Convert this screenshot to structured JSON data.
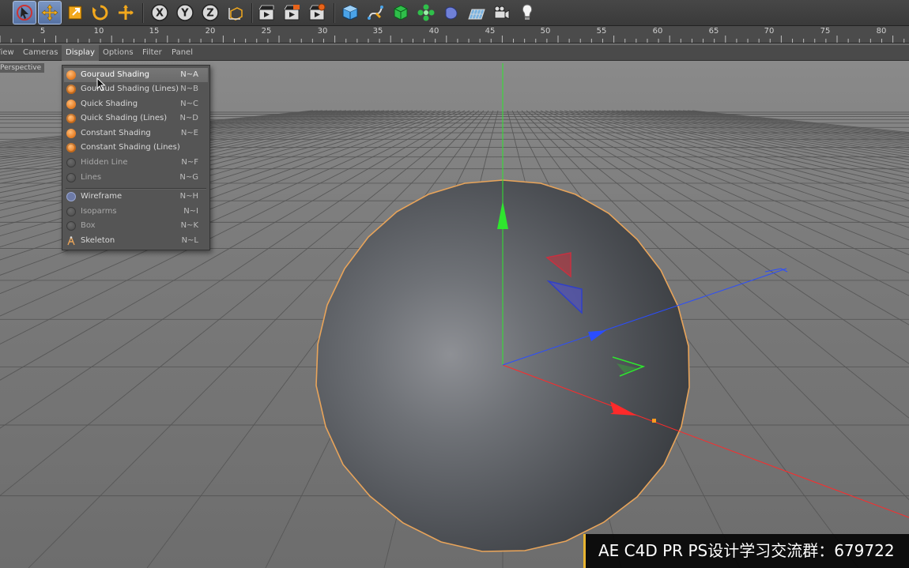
{
  "toolbar": {
    "tools": [
      {
        "name": "live-selection-icon",
        "active": true
      },
      {
        "name": "move-icon",
        "active": true
      },
      {
        "name": "scale-icon",
        "active": false
      },
      {
        "name": "rotate-icon",
        "active": false
      },
      {
        "name": "last-tool-icon",
        "active": false
      },
      {
        "name": "x-axis-lock-icon",
        "active": false
      },
      {
        "name": "y-axis-lock-icon",
        "active": false
      },
      {
        "name": "z-axis-lock-icon",
        "active": false
      },
      {
        "name": "coordinate-system-icon",
        "active": false
      },
      {
        "name": "render-view-icon",
        "active": false
      },
      {
        "name": "render-picture-viewer-icon",
        "active": false
      },
      {
        "name": "render-settings-icon",
        "active": false
      },
      {
        "name": "cube-primitive-icon",
        "active": false
      },
      {
        "name": "spline-pen-icon",
        "active": false
      },
      {
        "name": "subdivision-icon",
        "active": false
      },
      {
        "name": "cloner-icon",
        "active": false
      },
      {
        "name": "deformer-icon",
        "active": false
      },
      {
        "name": "floor-icon",
        "active": false
      },
      {
        "name": "camera-icon",
        "active": false
      },
      {
        "name": "light-icon",
        "active": false
      }
    ],
    "axis_letters": [
      "X",
      "Y",
      "Z"
    ]
  },
  "ruler": {
    "labels": [
      "5",
      "10",
      "15",
      "20",
      "25",
      "30",
      "35",
      "40",
      "45",
      "50",
      "55",
      "60",
      "65",
      "70",
      "75",
      "80"
    ]
  },
  "menubar": {
    "items": [
      "View",
      "Cameras",
      "Display",
      "Options",
      "Filter",
      "Panel"
    ],
    "open_item": "Display"
  },
  "viewport": {
    "camera_label": "Perspective"
  },
  "display_menu": {
    "items": [
      {
        "label": "Gouraud Shading",
        "shortcut": "N~A",
        "icon": "orange",
        "selected": true
      },
      {
        "label": "Gouraud Shading (Lines)",
        "shortcut": "N~B",
        "icon": "orange-line"
      },
      {
        "label": "Quick Shading",
        "shortcut": "N~C",
        "icon": "orange"
      },
      {
        "label": "Quick Shading (Lines)",
        "shortcut": "N~D",
        "icon": "orange-line"
      },
      {
        "label": "Constant Shading",
        "shortcut": "N~E",
        "icon": "orange"
      },
      {
        "label": "Constant Shading (Lines)",
        "shortcut": "",
        "icon": "orange-line"
      },
      {
        "label": "Hidden Line",
        "shortcut": "N~F",
        "icon": "gray",
        "dim": true
      },
      {
        "label": "Lines",
        "shortcut": "N~G",
        "icon": "gray",
        "dim": true
      },
      {
        "label": "Wireframe",
        "shortcut": "N~H",
        "icon": "wire"
      },
      {
        "label": "Isoparms",
        "shortcut": "N~I",
        "icon": "gray",
        "dim": true
      },
      {
        "label": "Box",
        "shortcut": "N~K",
        "icon": "gray",
        "dim": true
      },
      {
        "label": "Skeleton",
        "shortcut": "N~L",
        "icon": "skel"
      }
    ]
  },
  "colors": {
    "x_axis": "#ff2a2a",
    "y_axis": "#2ee62e",
    "z_axis": "#2a4dff",
    "selection_outline": "#e8a45a",
    "watermark_accent": "#e8b530"
  },
  "watermark": {
    "text": "AE C4D PR PS设计学习交流群：679722"
  }
}
